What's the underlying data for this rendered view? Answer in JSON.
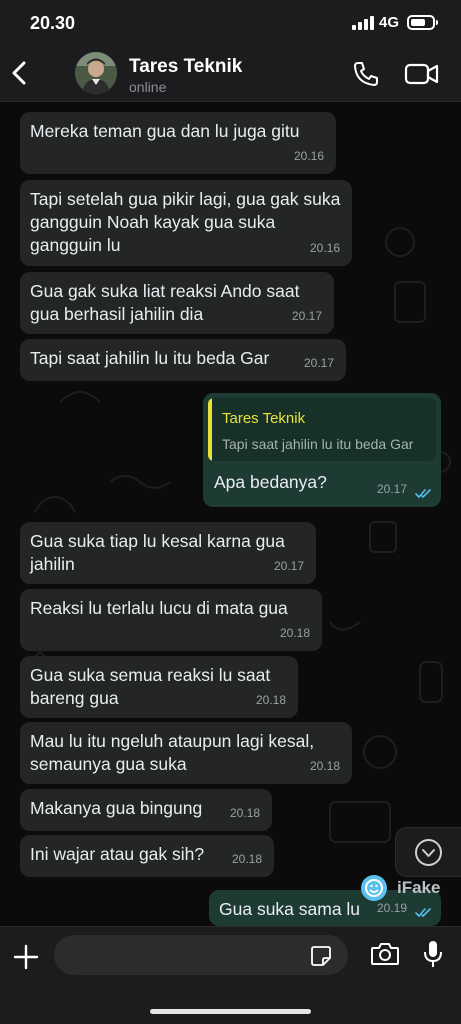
{
  "status_bar": {
    "time": "20.30",
    "network": "4G",
    "battery_level": 0.7
  },
  "header": {
    "name": "Tares Teknik",
    "status": "online"
  },
  "messages": [
    {
      "dir": "in",
      "text": "Mereka teman gua dan lu juga gitu",
      "time": "20.16"
    },
    {
      "dir": "in",
      "text": "Tapi setelah gua pikir lagi, gua gak suka gangguin Noah kayak gua suka gangguin lu",
      "time": "20.16"
    },
    {
      "dir": "in",
      "text": "Gua gak suka liat reaksi Ando saat gua berhasil jahilin dia",
      "time": "20.17"
    },
    {
      "dir": "in",
      "text": "Tapi saat jahilin lu itu beda Gar",
      "time": "20.17"
    },
    {
      "dir": "out",
      "quote_name": "Tares Teknik",
      "quote_text": "Tapi saat jahilin lu itu beda Gar",
      "text": "Apa bedanya?",
      "time": "20.17",
      "read": true
    },
    {
      "dir": "in",
      "text": "Gua suka tiap lu kesal karna gua jahilin",
      "time": "20.17"
    },
    {
      "dir": "in",
      "text": "Reaksi lu terlalu lucu di mata gua",
      "time": "20.18"
    },
    {
      "dir": "in",
      "text": "Gua suka semua reaksi lu saat bareng gua",
      "time": "20.18"
    },
    {
      "dir": "in",
      "text": "Mau lu itu ngeluh ataupun lagi kesal, semaunya gua suka",
      "time": "20.18"
    },
    {
      "dir": "in",
      "text": "Makanya gua bingung",
      "time": "20.18"
    },
    {
      "dir": "in",
      "text": "Ini wajar atau gak sih?",
      "time": "20.18"
    },
    {
      "dir": "out",
      "text": "Gua suka sama lu",
      "time": "20.19",
      "read": true
    }
  ],
  "watermark": {
    "text": "iFake"
  },
  "composer": {
    "placeholder": ""
  },
  "colors": {
    "incoming": "#242626",
    "outgoing": "#1e3b33",
    "quote_accent": "#e7e23a",
    "read_ticks": "#53bdeb"
  }
}
